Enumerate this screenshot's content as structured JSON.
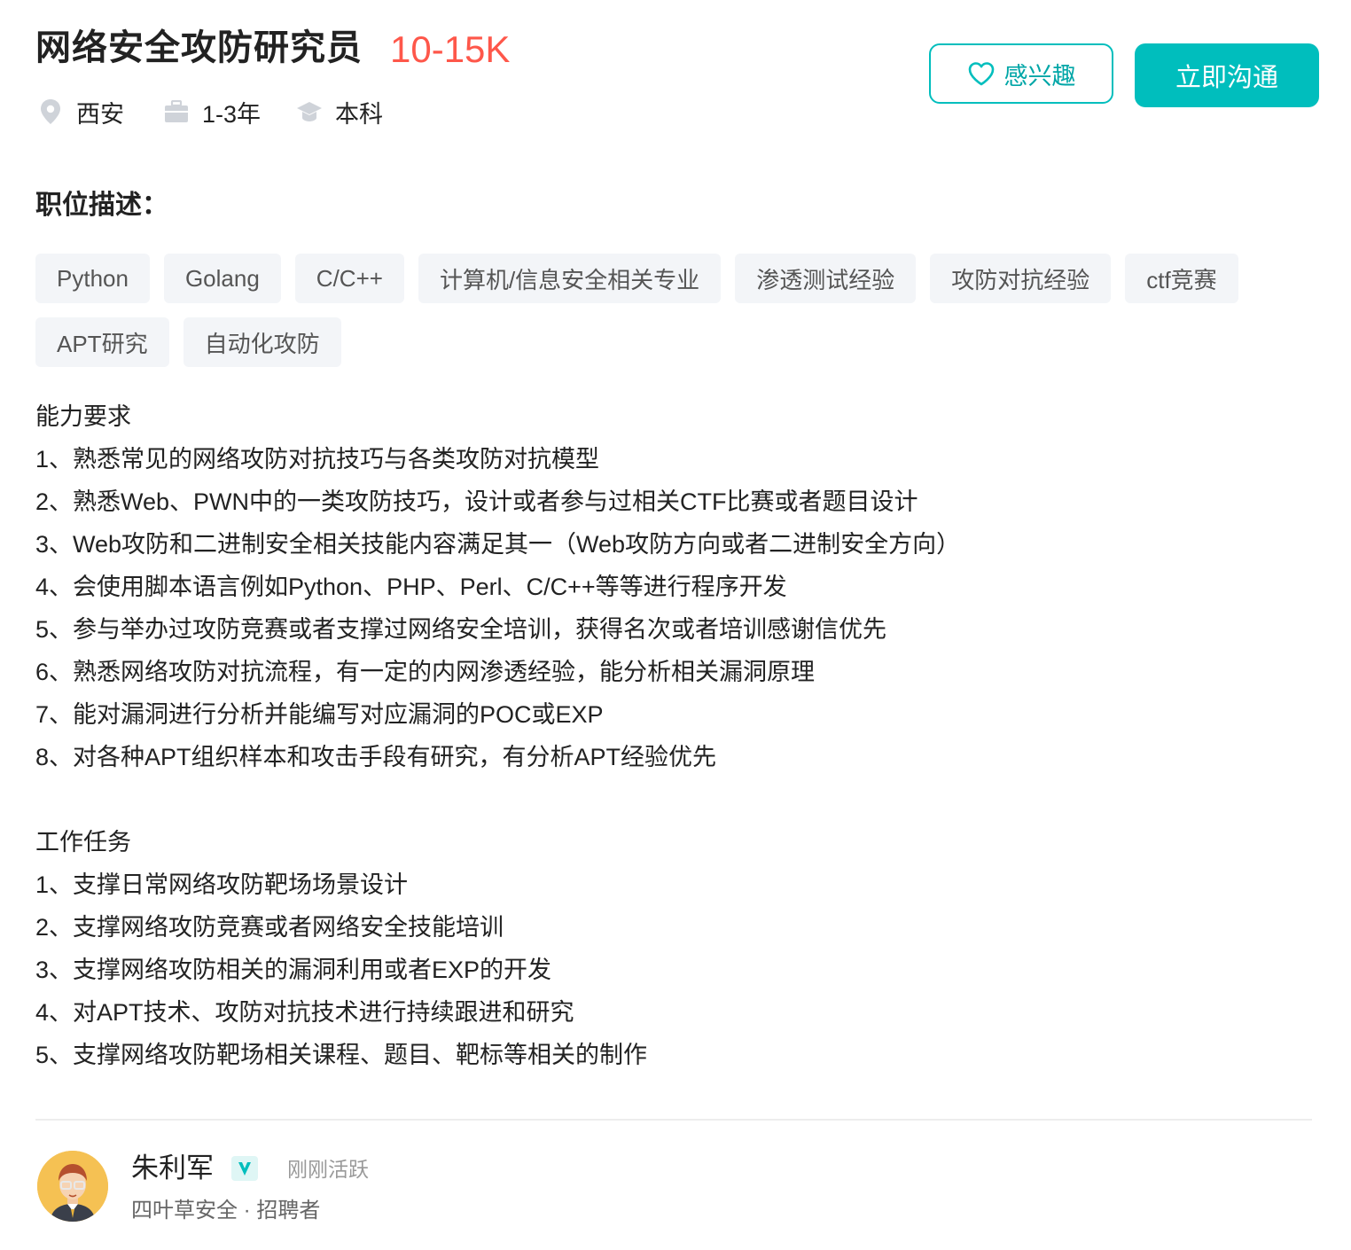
{
  "job": {
    "title": "网络安全攻防研究员",
    "salary": "10-15K",
    "location": "西安",
    "experience": "1-3年",
    "education": "本科"
  },
  "actions": {
    "interest_label": "感兴趣",
    "chat_label": "立即沟通"
  },
  "description": {
    "heading": "职位描述：",
    "tags": [
      "Python",
      "Golang",
      "C/C++",
      "计算机/信息安全相关专业",
      "渗透测试经验",
      "攻防对抗经验",
      "ctf竞赛",
      "APT研究",
      "自动化攻防"
    ],
    "requirements_heading": "能力要求",
    "requirements": [
      "1、熟悉常见的网络攻防对抗技巧与各类攻防对抗模型",
      "2、熟悉Web、PWN中的一类攻防技巧，设计或者参与过相关CTF比赛或者题目设计",
      "3、Web攻防和二进制安全相关技能内容满足其一（Web攻防方向或者二进制安全方向）",
      "4、会使用脚本语言例如Python、PHP、Perl、C/C++等等进行程序开发",
      "5、参与举办过攻防竞赛或者支撑过网络安全培训，获得名次或者培训感谢信优先",
      "6、熟悉网络攻防对抗流程，有一定的内网渗透经验，能分析相关漏洞原理",
      "7、能对漏洞进行分析并能编写对应漏洞的POC或EXP",
      "8、对各种APT组织样本和攻击手段有研究，有分析APT经验优先"
    ],
    "tasks_heading": "工作任务",
    "tasks": [
      "1、支撑日常网络攻防靶场场景设计",
      "2、支撑网络攻防竞赛或者网络安全技能培训",
      "3、支撑网络攻防相关的漏洞利用或者EXP的开发",
      "4、对APT技术、攻防对抗技术进行持续跟进和研究",
      "5、支撑网络攻防靶场相关课程、题目、靶标等相关的制作"
    ]
  },
  "recruiter": {
    "name": "朱利军",
    "status": "刚刚活跃",
    "company_role": "四叶草安全 · 招聘者"
  },
  "colors": {
    "accent": "#00bebd",
    "salary": "#fe574a"
  }
}
